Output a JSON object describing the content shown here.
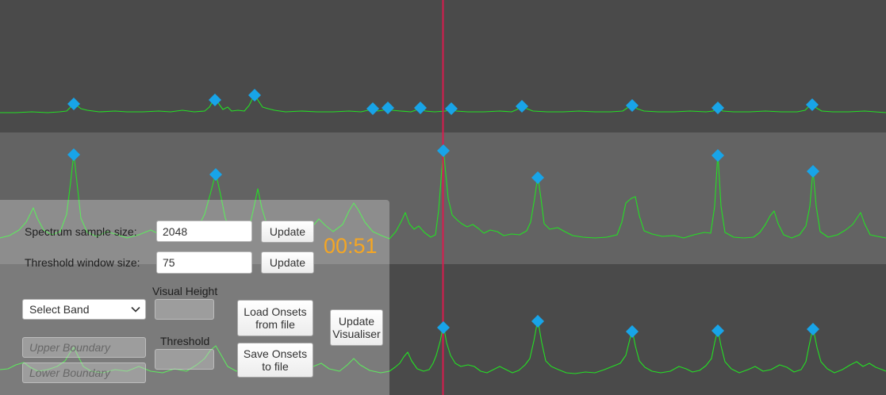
{
  "timer": {
    "elapsed": "00:51"
  },
  "colors": {
    "timer_text": "#f5a623",
    "playhead": "#d91c4f",
    "onset_marker": "#18a4e8",
    "waveform": "#24e024"
  },
  "settings": {
    "spectrum_sample_size": {
      "label": "Spectrum sample size:",
      "value": "2048",
      "update_button": "Update"
    },
    "threshold_window_size": {
      "label": "Threshold window size:",
      "value": "75",
      "update_button": "Update"
    }
  },
  "band": {
    "dropdown": {
      "selected": "Select Band",
      "icon": "chevron-down-icon"
    },
    "visual_height": {
      "label": "Visual Height"
    },
    "threshold": {
      "label": "Threshold"
    },
    "upper_boundary": {
      "placeholder": "Upper Boundary"
    },
    "lower_boundary": {
      "placeholder": "Lower Boundary"
    }
  },
  "actions": {
    "load_onsets": "Load Onsets from file",
    "save_onsets": "Save Onsets to file",
    "update_visualiser": "Update Visualiser"
  }
}
